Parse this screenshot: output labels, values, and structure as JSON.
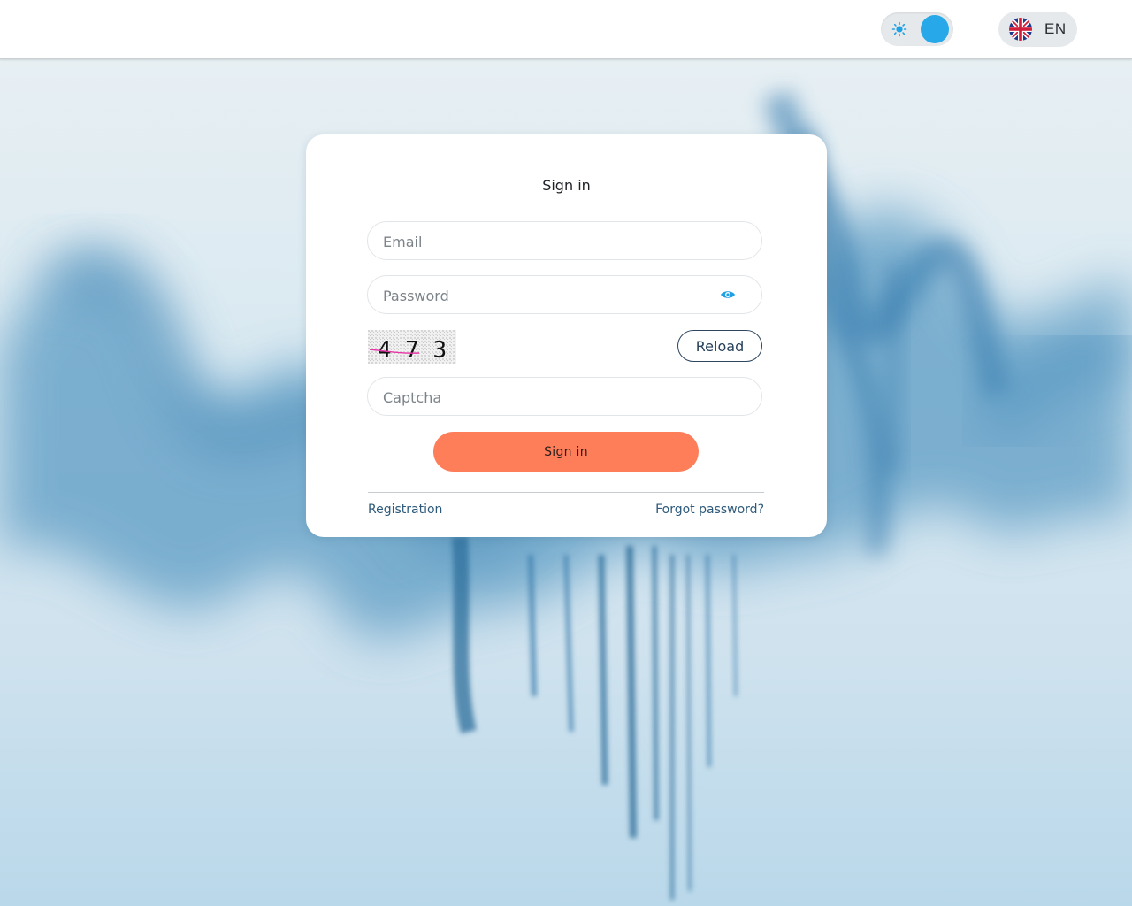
{
  "header": {
    "theme_toggle": {
      "light_icon": "sun-icon",
      "dark_icon": "moon-icon",
      "active": "dark",
      "accent": "#27a8e8"
    },
    "language": {
      "code": "EN",
      "flag_icon": "uk-flag-icon"
    }
  },
  "login": {
    "title": "Sign in",
    "email": {
      "placeholder": "Email",
      "value": ""
    },
    "password": {
      "placeholder": "Password",
      "value": "",
      "toggle_icon": "eye-icon"
    },
    "captcha_image": {
      "digits": "4 7 3"
    },
    "reload_label": "Reload",
    "captcha": {
      "placeholder": "Captcha",
      "value": ""
    },
    "submit_label": "Sign in",
    "submit_color": "#ff7e5a",
    "registration_link": "Registration",
    "forgot_link": "Forgot password?"
  }
}
